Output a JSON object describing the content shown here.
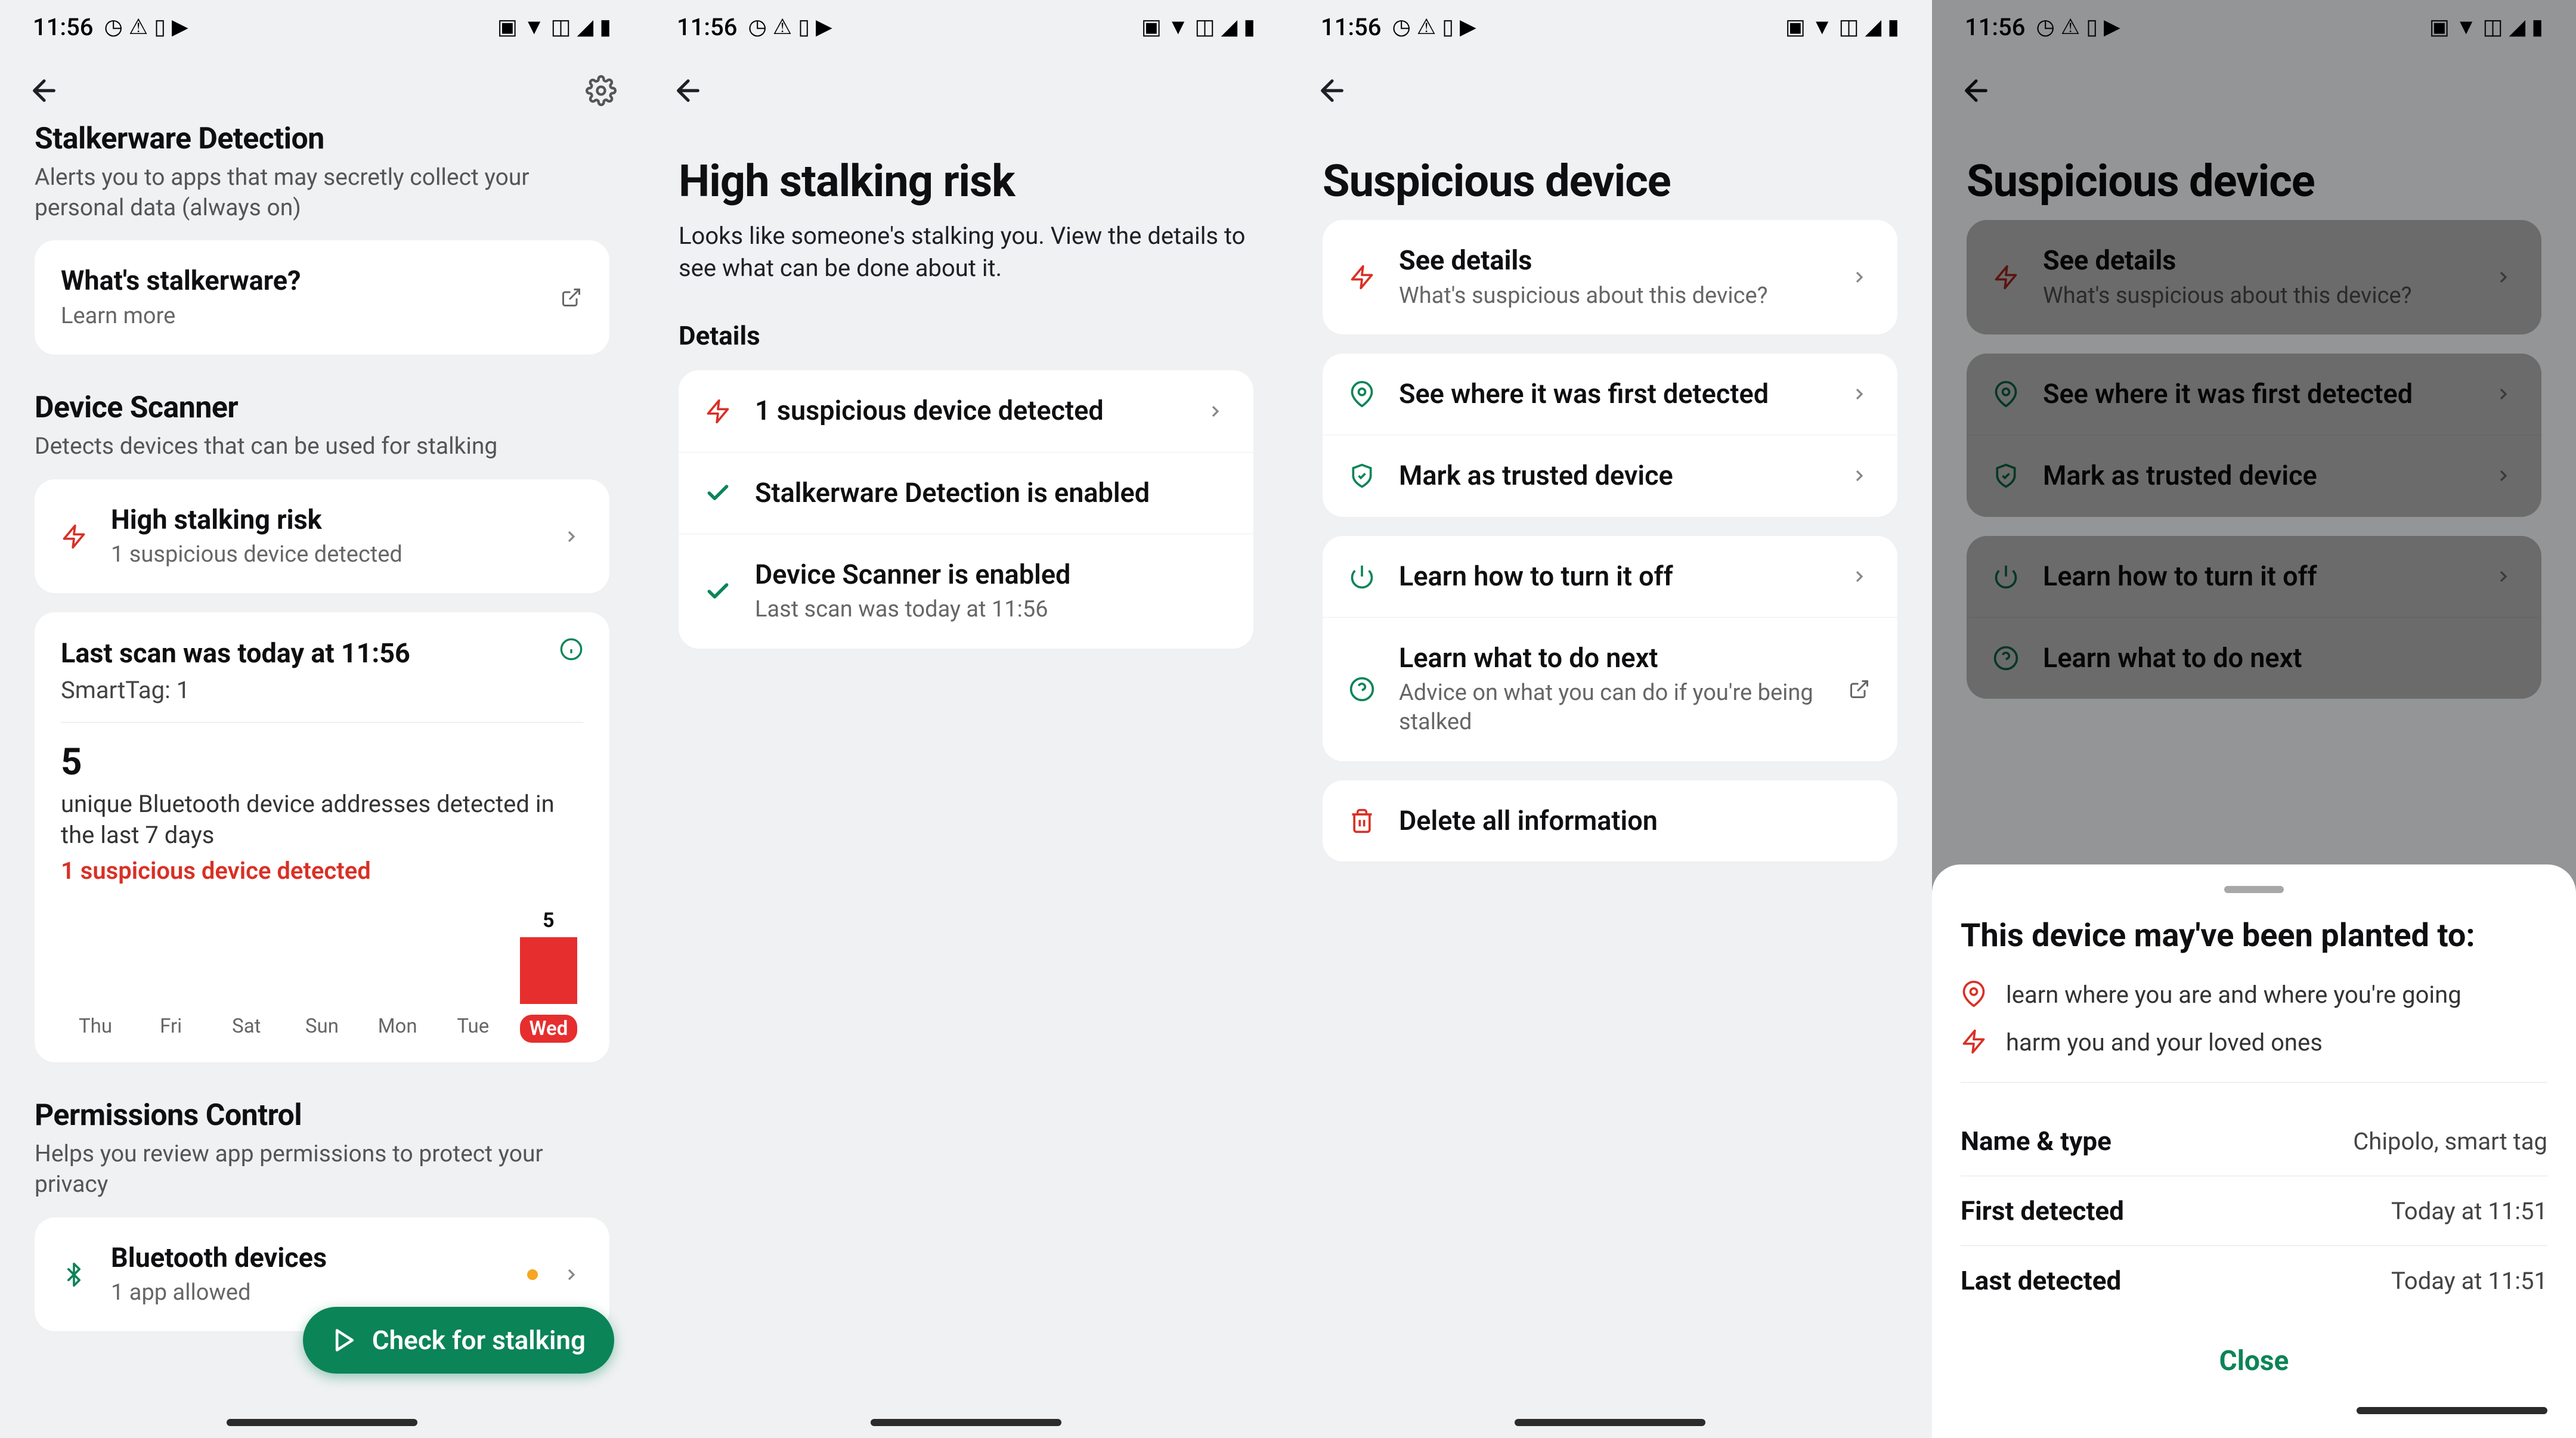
{
  "status": {
    "time": "11:56"
  },
  "colors": {
    "accent": "#0b8457",
    "danger": "#d93025",
    "bar": "#e62e2e"
  },
  "screen1": {
    "section_stalker": {
      "title": "Stalkerware Detection",
      "desc": "Alerts you to apps that may secretly collect your personal data (always on)"
    },
    "whats": {
      "title": "What's stalkerware?",
      "sub": "Learn more"
    },
    "section_scanner": {
      "title": "Device Scanner",
      "desc": "Detects devices that can be used for stalking"
    },
    "risk": {
      "title": "High stalking risk",
      "sub": "1 suspicious device detected"
    },
    "scan": {
      "title": "Last scan was today at 11:56",
      "tag": "SmartTag: 1",
      "big": "5",
      "desc": "unique Bluetooth device addresses detected in the last 7 days",
      "alert": "1 suspicious device detected"
    },
    "section_perms": {
      "title": "Permissions Control",
      "desc": "Helps you review app permissions to protect your privacy"
    },
    "bt": {
      "title": "Bluetooth devices",
      "sub": "1 app allowed"
    },
    "fab": "Check for stalking"
  },
  "chart_data": {
    "type": "bar",
    "categories": [
      "Thu",
      "Fri",
      "Sat",
      "Sun",
      "Mon",
      "Tue",
      "Wed"
    ],
    "values": [
      0,
      0,
      0,
      0,
      0,
      0,
      5
    ],
    "active_index": 6,
    "title": "unique Bluetooth device addresses detected in the last 7 days",
    "xlabel": "",
    "ylabel": "",
    "ylim": [
      0,
      5
    ]
  },
  "screen2": {
    "title": "High stalking risk",
    "sub": "Looks like someone's stalking you. View the details to see what can be done about it.",
    "details_heading": "Details",
    "items": [
      {
        "title": "1 suspicious device detected"
      },
      {
        "title": "Stalkerware Detection is enabled"
      },
      {
        "title": "Device Scanner is enabled",
        "sub": "Last scan was today at 11:56"
      }
    ]
  },
  "screen3": {
    "title": "Suspicious device",
    "see_details": {
      "title": "See details",
      "sub": "What's suspicious about this device?"
    },
    "first_detected": "See where it was first detected",
    "trusted": "Mark as trusted device",
    "turn_off": "Learn how to turn it off",
    "do_next": {
      "title": "Learn what to do next",
      "sub": "Advice on what you can do if you're being stalked"
    },
    "delete": "Delete all information"
  },
  "sheet": {
    "title": "This device may've been planted to:",
    "bullets": [
      "learn where you are and where you're going",
      "harm you and your loved ones"
    ],
    "rows": [
      {
        "k": "Name & type",
        "v": "Chipolo, smart tag"
      },
      {
        "k": "First detected",
        "v": "Today at 11:51"
      },
      {
        "k": "Last detected",
        "v": "Today at 11:51"
      }
    ],
    "close": "Close"
  }
}
